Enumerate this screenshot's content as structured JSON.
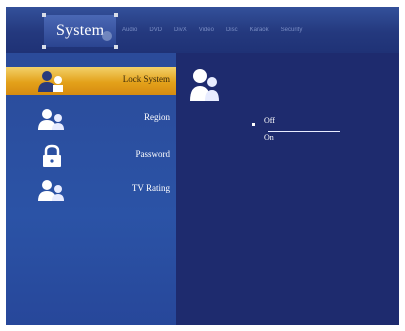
{
  "header": {
    "active_tab": "System",
    "other_tabs": [
      "Audio",
      "DVD",
      "DivX",
      "Video",
      "Disc",
      "Karaok",
      "Security"
    ]
  },
  "sidebar": {
    "items": [
      {
        "label": "Lock System",
        "icon": "user-lock-icon",
        "selected": true
      },
      {
        "label": "Region",
        "icon": "user-icon",
        "selected": false
      },
      {
        "label": "Password",
        "icon": "padlock-icon",
        "selected": false
      },
      {
        "label": "TV Rating",
        "icon": "user-icon",
        "selected": false
      }
    ]
  },
  "panel": {
    "icon": "user-icon",
    "options": [
      {
        "label": "Off",
        "selected": true
      },
      {
        "label": "On",
        "selected": false
      }
    ]
  },
  "colors": {
    "background": "#1e2b6e",
    "sidebar": "#2b53a6",
    "highlight": "#e3a11a",
    "text": "#ffffff"
  }
}
